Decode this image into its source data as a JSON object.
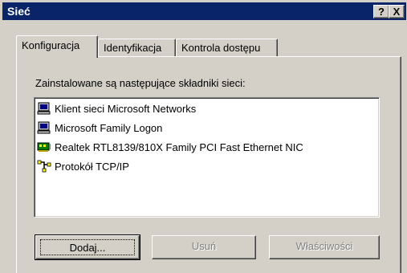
{
  "window": {
    "title": "Sieć",
    "help_glyph": "?",
    "close_glyph": "X"
  },
  "tabs": [
    {
      "label": "Konfiguracja",
      "active": true
    },
    {
      "label": "Identyfikacja",
      "active": false
    },
    {
      "label": "Kontrola dostępu",
      "active": false
    }
  ],
  "installed_label": "Zainstalowane są następujące składniki sieci:",
  "components": [
    {
      "label": "Klient sieci Microsoft Networks",
      "icon": "network-client-icon"
    },
    {
      "label": "Microsoft Family Logon",
      "icon": "network-client-icon"
    },
    {
      "label": "Realtek RTL8139/810X Family PCI Fast Ethernet NIC",
      "icon": "network-adapter-icon"
    },
    {
      "label": "Protokół TCP/IP",
      "icon": "protocol-icon"
    }
  ],
  "buttons": {
    "add": "Dodaj...",
    "remove": "Usuń",
    "properties": "Właściwości"
  },
  "colors": {
    "titlebar": "#0a246a",
    "face": "#d4d0c8"
  }
}
